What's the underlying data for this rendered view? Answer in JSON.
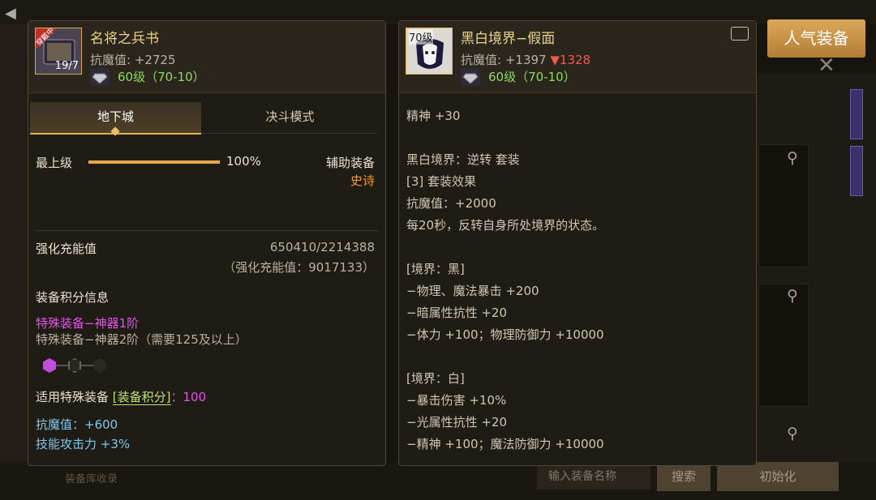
{
  "background": {
    "search_placeholder": "输入装备名称",
    "search_button": "搜索",
    "reset_button": "初始化",
    "popular_button": "人气装备",
    "bottom_hint": "装备库收录"
  },
  "left_item": {
    "name": "名将之兵书",
    "icon_badge": "穿戴中",
    "icon_label": "19/7",
    "stat_label": "抗魔值",
    "stat_value": ": +2725",
    "level_text": "60级（70-10）",
    "tabs": [
      "地下城",
      "决斗模式"
    ],
    "progress_label": "最上级",
    "progress_value": 1.0,
    "progress_text": "100%",
    "aux_label": "辅助装备",
    "aux_rarity": "史诗",
    "charge_label": "强化充能值",
    "charge_value": "650410/2214388",
    "charge_total": "（强化充能值：9017133）",
    "score_title": "装备积分信息",
    "special_1": "特殊装备−神器1阶",
    "special_2": "特殊装备−神器2阶（需要125及以上）",
    "score_line_prefix": "适用特殊装备",
    "score_line_tag": "[装备积分]",
    "score_line_value": "：100",
    "bonus_1": "抗魔值：+600",
    "bonus_2": "技能攻击力 +3%",
    "colors": {
      "title": "#ecd38a",
      "epic": "#f0a030",
      "special": "#e354e8",
      "bonus": "#7ec8f0",
      "level": "#8fdc5c"
    }
  },
  "right_item": {
    "name": "黑白境界−假面",
    "level_badge": "70级",
    "stat_label": "抗魔值",
    "stat_value": ": +1397",
    "stat_diff": "▼1328",
    "level_text": "60级（70-10）",
    "lines": [
      "精神 +30",
      "",
      "黑白境界：逆转 套装",
      "[3] 套装效果",
      "抗魔值：+2000",
      "每20秒，反转自身所处境界的状态。",
      "",
      "[境界：黑]",
      "−物理、魔法暴击 +200",
      "−暗属性抗性 +20",
      "−体力 +100；物理防御力 +10000",
      "",
      "[境界：白]",
      "−暴击伤害 +10%",
      "−光属性抗性 +20",
      "−精神 +100；魔法防御力 +10000"
    ]
  }
}
